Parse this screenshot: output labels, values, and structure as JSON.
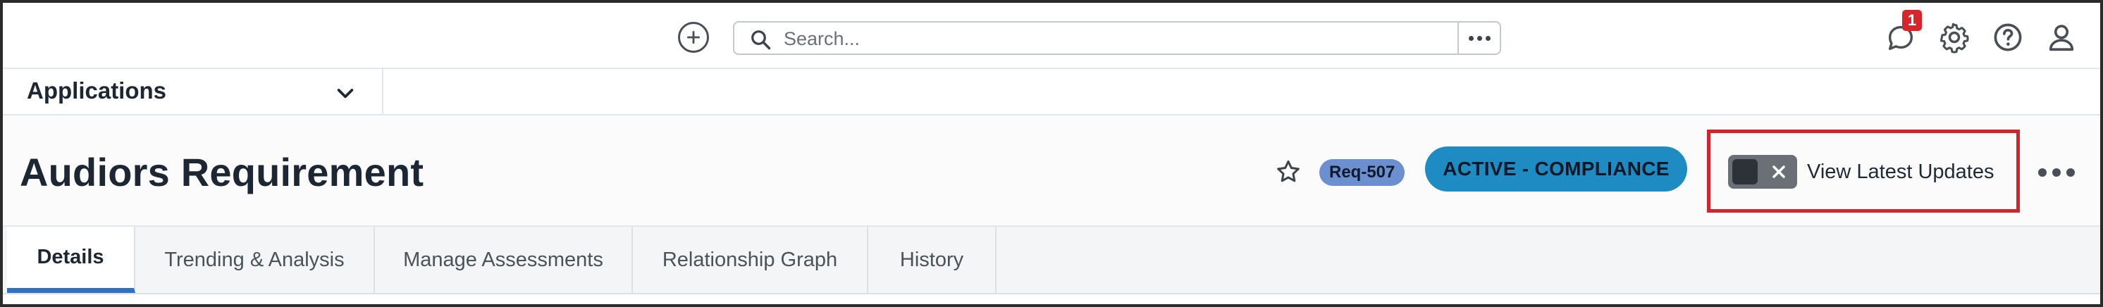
{
  "topbar": {
    "search_placeholder": "Search...",
    "notification_count": "1"
  },
  "applications": {
    "label": "Applications"
  },
  "header": {
    "title": "Audiors Requirement",
    "record_id": "Req-507",
    "status": "ACTIVE - COMPLIANCE",
    "toggle_label": "View Latest Updates",
    "toggle_on": false
  },
  "tabs": [
    {
      "label": "Details",
      "active": true
    },
    {
      "label": "Trending & Analysis",
      "active": false
    },
    {
      "label": "Manage Assessments",
      "active": false
    },
    {
      "label": "Relationship Graph",
      "active": false
    },
    {
      "label": "History",
      "active": false
    }
  ],
  "colors": {
    "status_bg": "#1e8bc3",
    "record_badge_bg": "#6b8fcf",
    "highlight_box": "#d0262b",
    "active_tab_indicator": "#2f6fc4",
    "notification_badge": "#d6262c"
  }
}
